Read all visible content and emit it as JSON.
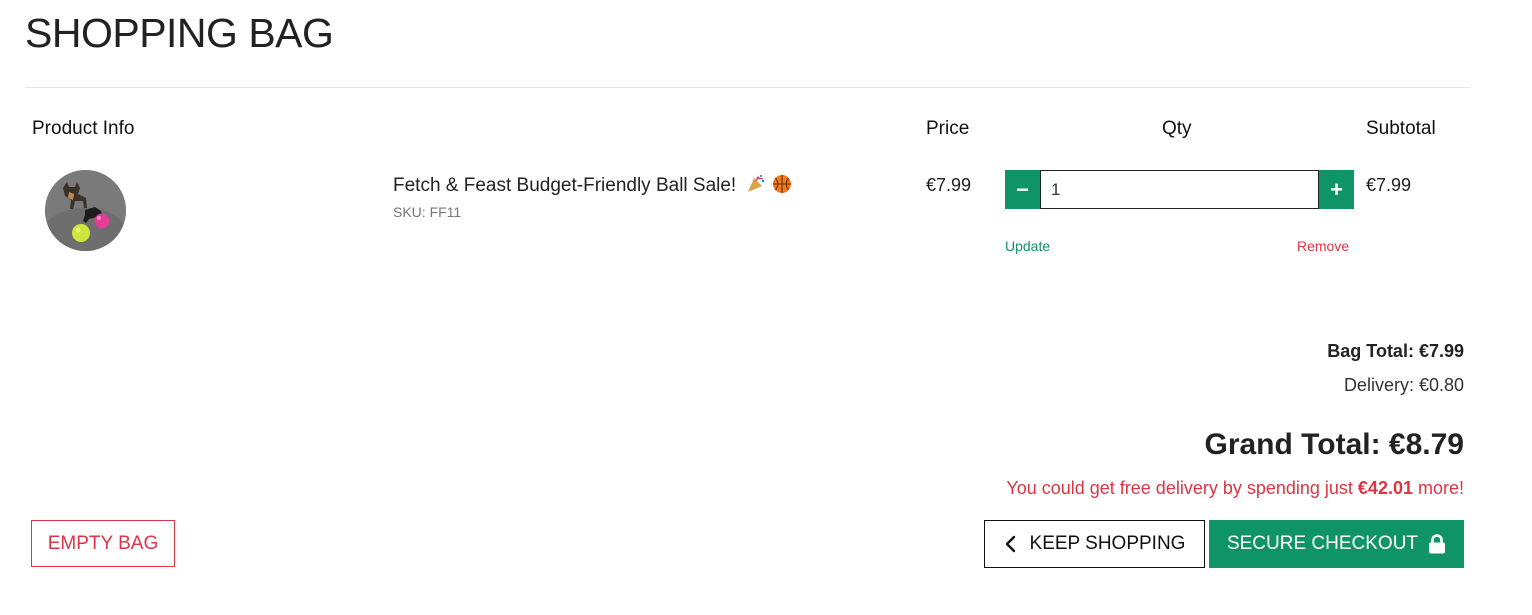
{
  "page": {
    "title": "SHOPPING BAG"
  },
  "table": {
    "headers": {
      "product_info": "Product Info",
      "price": "Price",
      "qty": "Qty",
      "subtotal": "Subtotal"
    },
    "items": [
      {
        "name": "Fetch & Feast Budget-Friendly Ball Sale!",
        "emojis": "🎉 🏀",
        "sku": "SKU: FF11",
        "price": "€7.99",
        "quantity": "1",
        "subtotal": "€7.99",
        "update_label": "Update",
        "remove_label": "Remove",
        "minus_label": "−",
        "plus_label": "+"
      }
    ]
  },
  "totals": {
    "bag_total": "Bag Total: €7.99",
    "delivery": "Delivery: €0.80",
    "grand_total": "Grand Total: €8.79",
    "free_delivery_prefix": "You could get free delivery by spending just ",
    "free_delivery_amount": "€42.01",
    "free_delivery_suffix": " more!"
  },
  "buttons": {
    "empty_bag": "EMPTY BAG",
    "keep_shopping": "KEEP SHOPPING",
    "secure_checkout": "SECURE CHECKOUT"
  },
  "colors": {
    "accent": "#0f9467",
    "danger": "#dc3545",
    "text": "#222222"
  },
  "icons": {
    "keep_shopping": "chevron-left-icon",
    "checkout": "lock-icon"
  }
}
